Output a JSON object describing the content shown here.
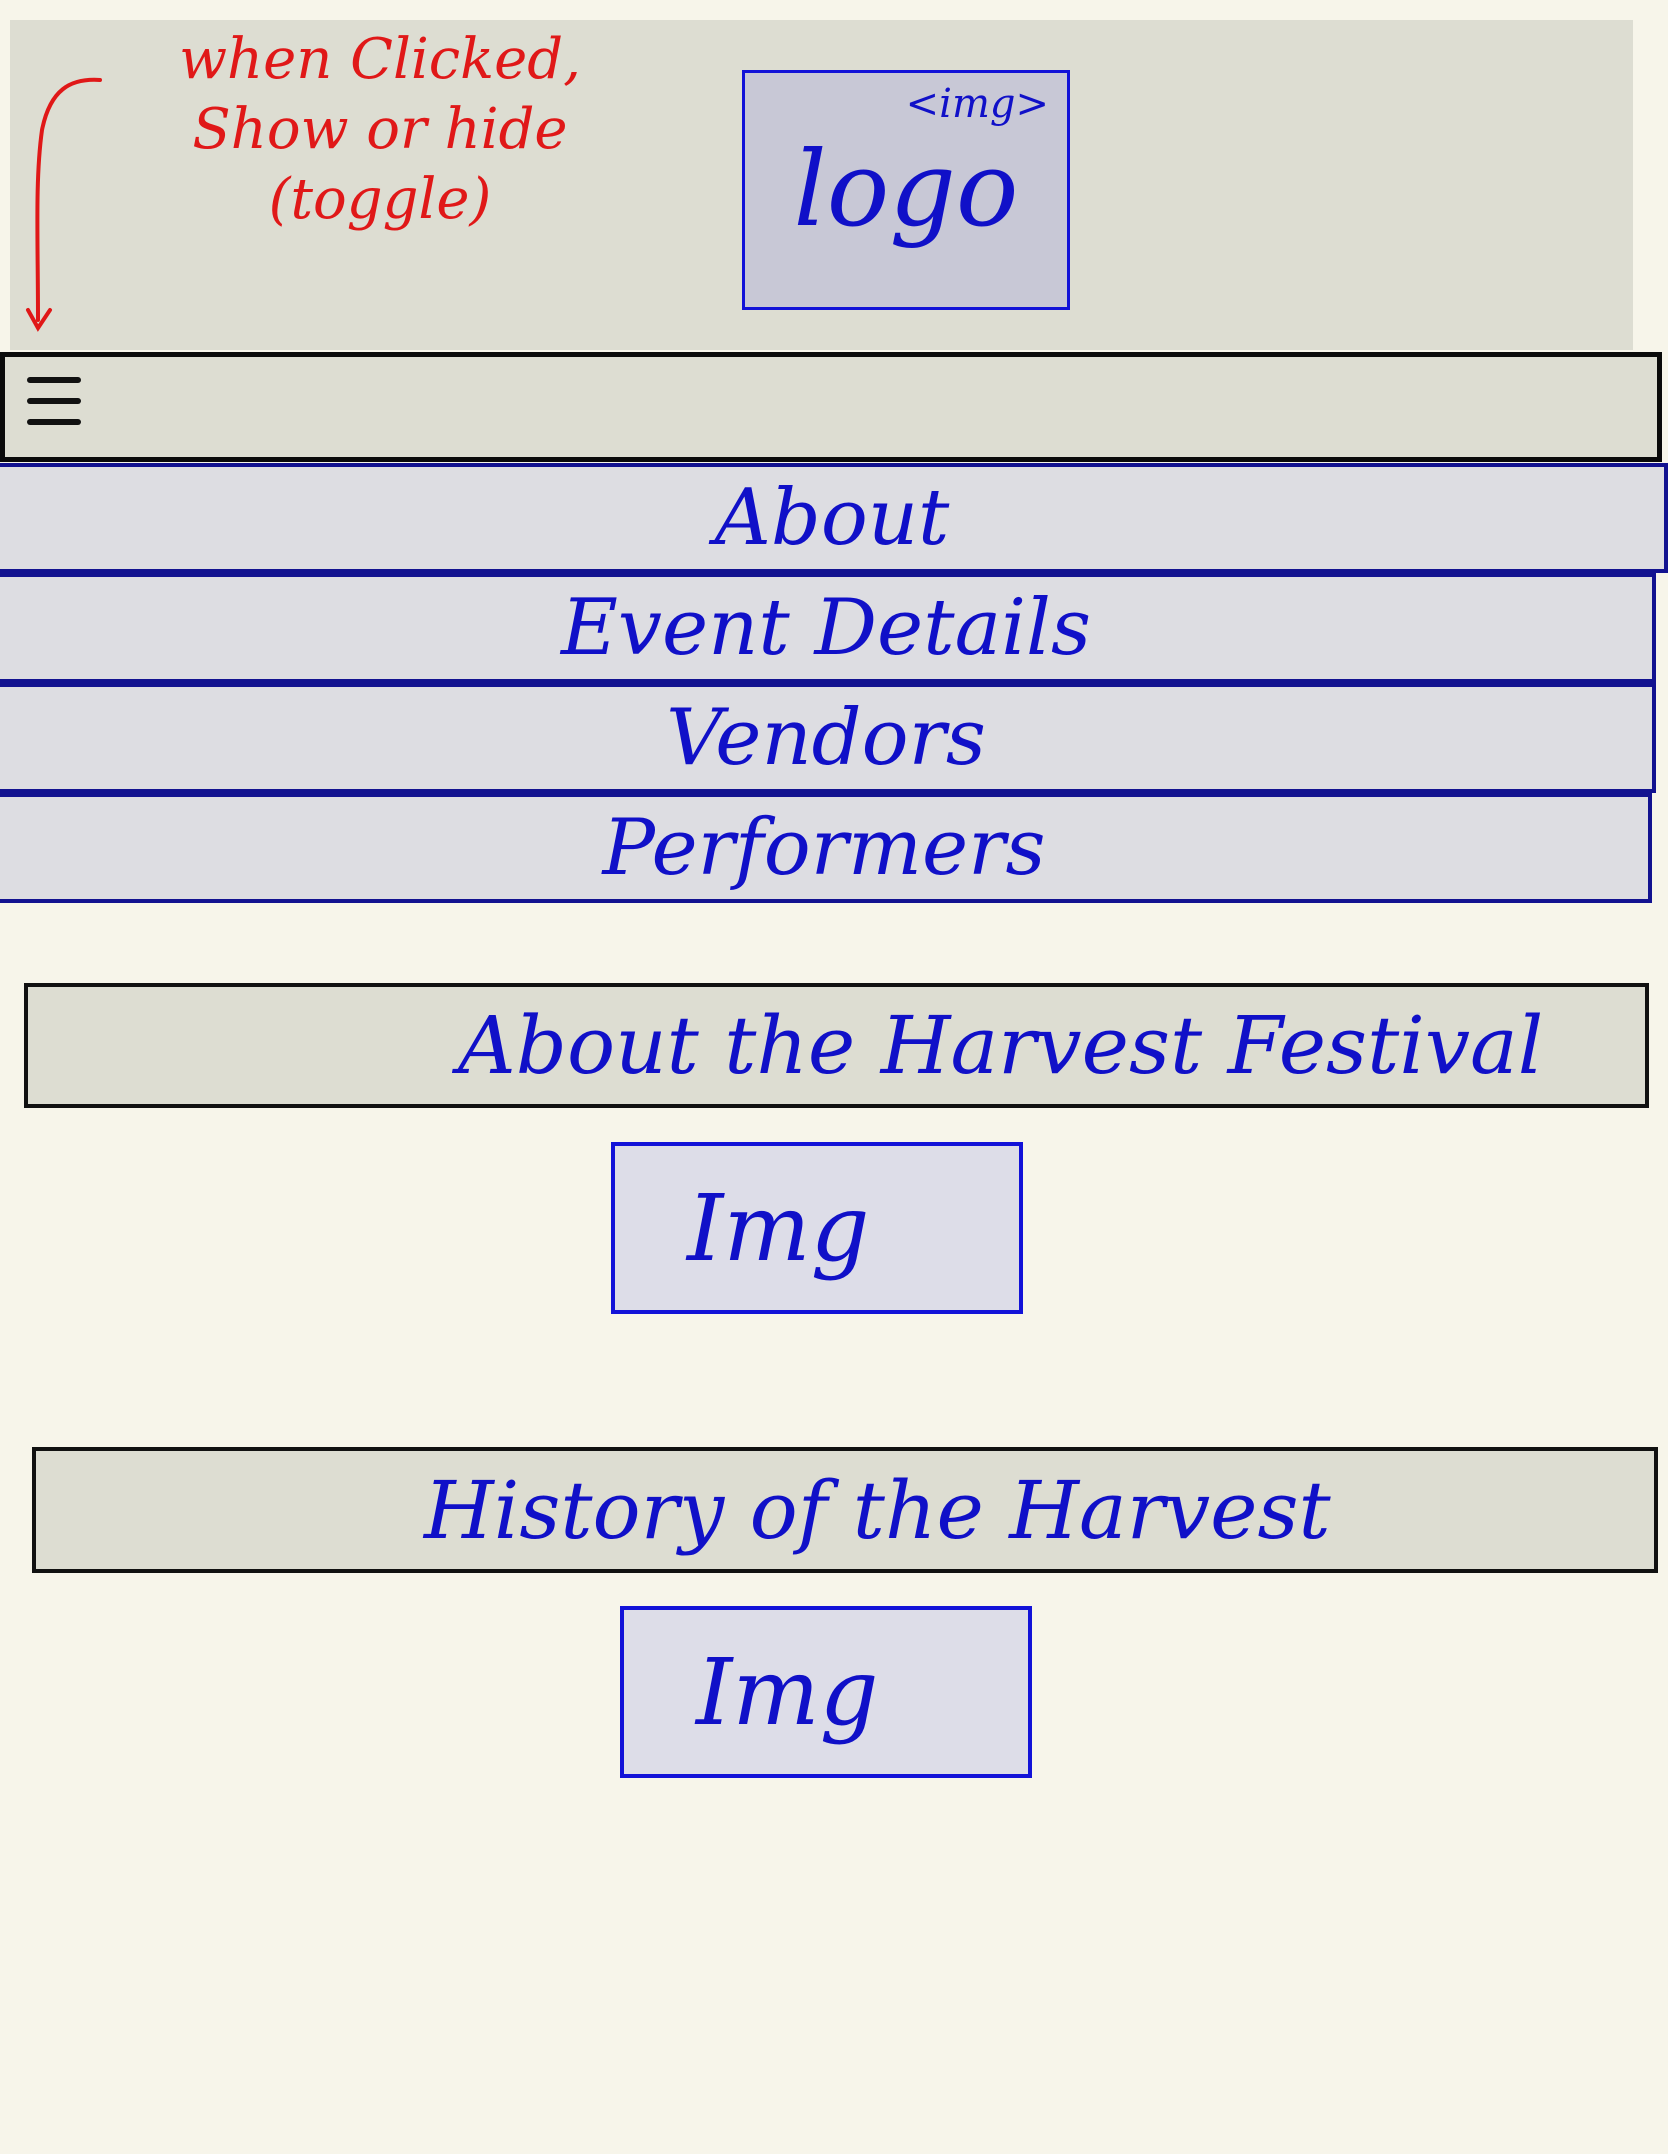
{
  "annotation": {
    "text": "when Clicked,\nShow or hide\n(toggle)",
    "color": "#e01818"
  },
  "header": {
    "logo_tag": "<img>",
    "logo_label": "logo"
  },
  "menu": {
    "icon": "hamburger-icon"
  },
  "nav": {
    "items": [
      {
        "label": "About"
      },
      {
        "label": "Event Details"
      },
      {
        "label": "Vendors"
      },
      {
        "label": "Performers"
      }
    ]
  },
  "sections": [
    {
      "heading": "About the Harvest Festival",
      "image_label": "Img"
    },
    {
      "heading": "History of the Harvest",
      "image_label": "Img"
    }
  ],
  "colors": {
    "ink_blue": "#1010c8",
    "annotation_red": "#e01818",
    "header_bg": "#ddddd2",
    "page_bg": "#f7f5ea"
  }
}
